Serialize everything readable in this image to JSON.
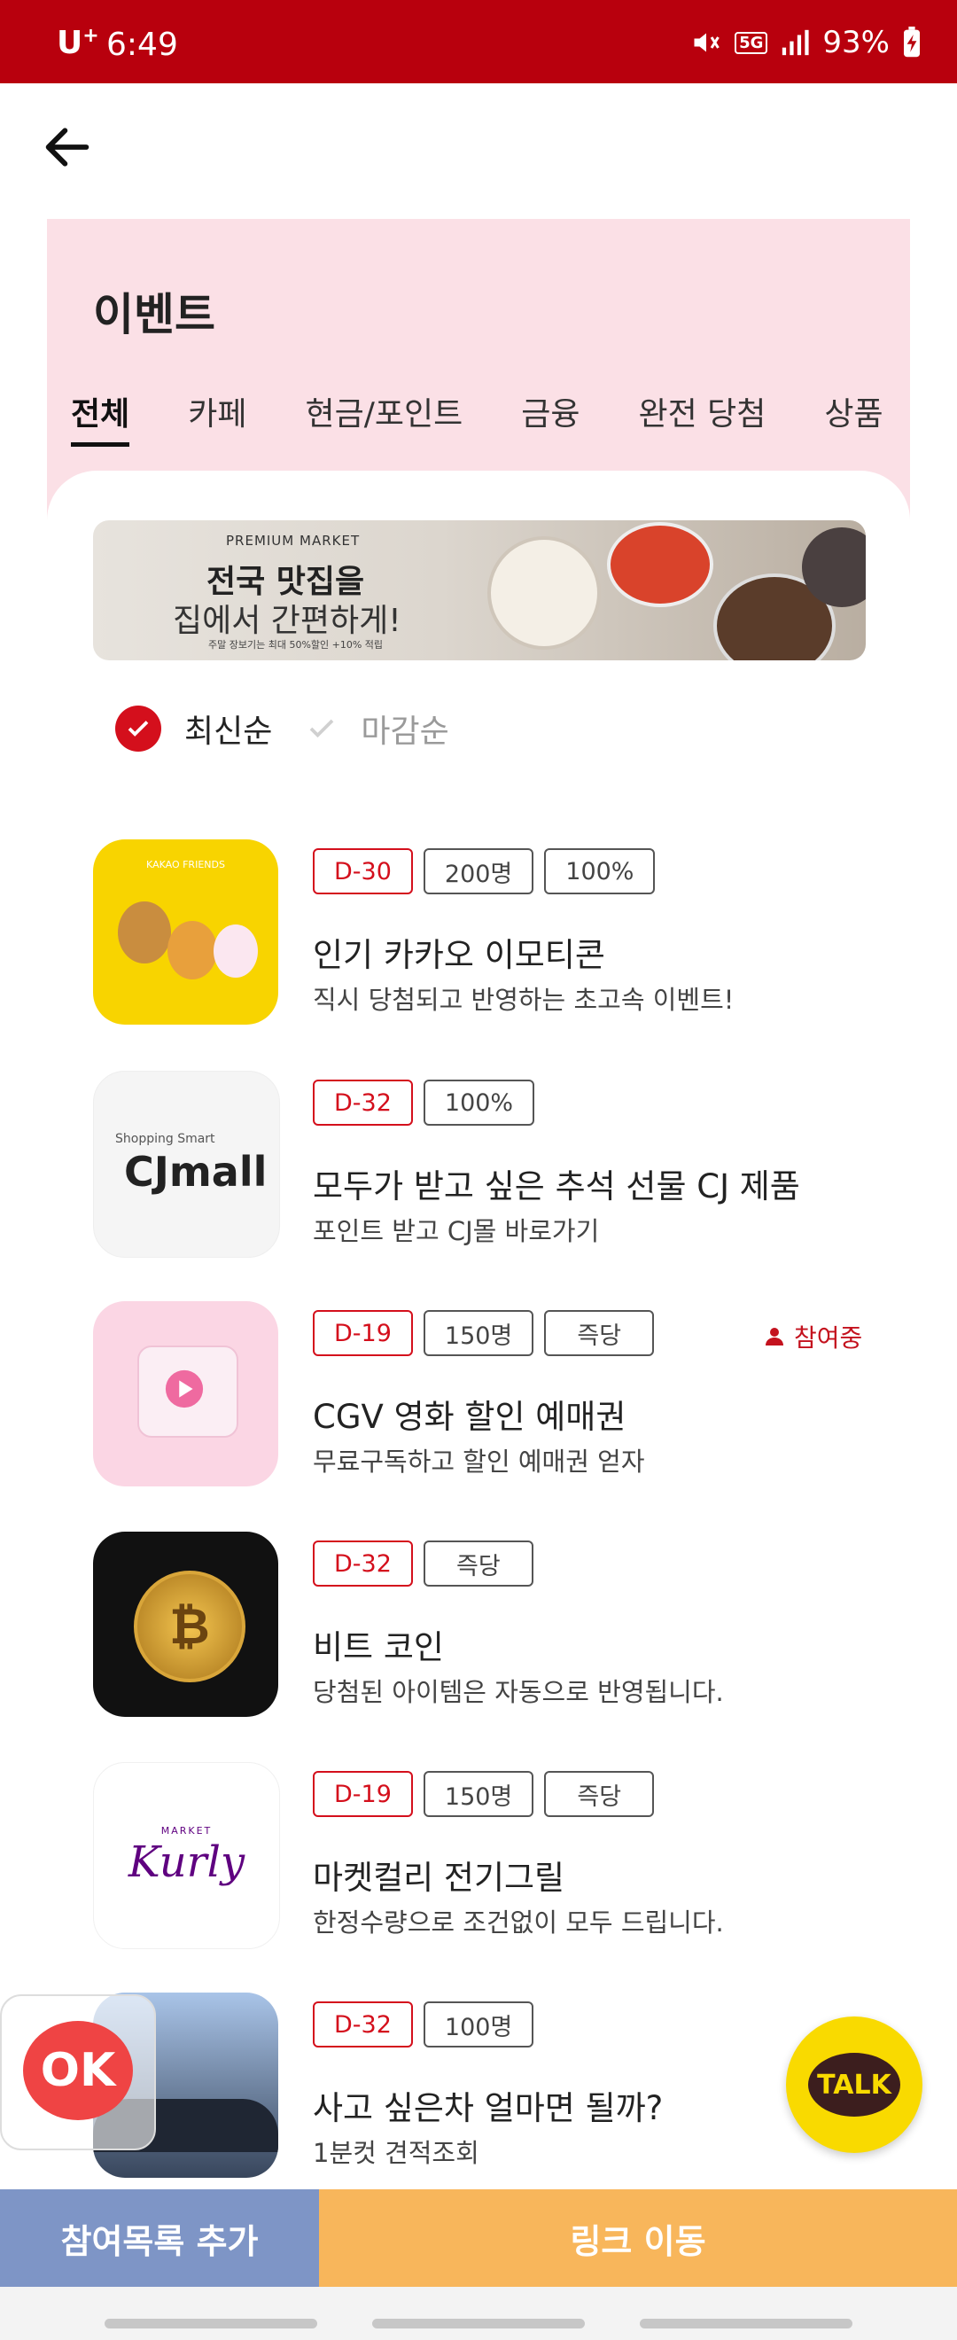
{
  "status_bar": {
    "carrier": "U",
    "carrier_plus": "+",
    "time": "6:49",
    "network": "5G",
    "battery": "93%"
  },
  "header": {
    "title": "이벤트",
    "tabs": [
      {
        "label": "전체",
        "active": true
      },
      {
        "label": "카페",
        "active": false
      },
      {
        "label": "현금/포인트",
        "active": false
      },
      {
        "label": "금융",
        "active": false
      },
      {
        "label": "완전 당첨",
        "active": false
      },
      {
        "label": "상품",
        "active": false
      }
    ]
  },
  "banner": {
    "tag": "PREMIUM MARKET",
    "line1": "전국 맛집을",
    "line2": "집에서 간편하게!",
    "fine_print": "주말 장보기는 최대 50%할인 +10% 적립"
  },
  "sort": {
    "options": [
      {
        "label": "최신순",
        "selected": true
      },
      {
        "label": "마감순",
        "selected": false
      }
    ]
  },
  "events": [
    {
      "badges": [
        {
          "text": "D-30",
          "red": true
        },
        {
          "text": "200명",
          "red": false
        },
        {
          "text": "100%",
          "red": false
        }
      ],
      "title": "인기 카카오 이모티콘",
      "subtitle": "직시 당첨되고 반영하는 초고속 이벤트!",
      "thumb_text": "KAKAO FRIENDS",
      "participating": ""
    },
    {
      "badges": [
        {
          "text": "D-32",
          "red": true
        },
        {
          "text": "100%",
          "red": false
        }
      ],
      "title": "모두가 받고 싶은 추석 선물 CJ 제품",
      "subtitle": "포인트 받고 CJ몰 바로가기",
      "thumb_text": "CJmall",
      "thumb_sub": "Shopping Smart",
      "participating": ""
    },
    {
      "badges": [
        {
          "text": "D-19",
          "red": true
        },
        {
          "text": "150명",
          "red": false
        },
        {
          "text": "즉당",
          "red": false
        }
      ],
      "title": "CGV 영화 할인 예매권",
      "subtitle": "무료구독하고 할인 예매권 얻자",
      "participating": "참여중"
    },
    {
      "badges": [
        {
          "text": "D-32",
          "red": true
        },
        {
          "text": "즉당",
          "red": false
        }
      ],
      "title": "비트 코인",
      "subtitle": "당첨된 아이템은 자동으로 반영됩니다.",
      "participating": ""
    },
    {
      "badges": [
        {
          "text": "D-19",
          "red": true
        },
        {
          "text": "150명",
          "red": false
        },
        {
          "text": "즉당",
          "red": false
        }
      ],
      "title": "마켓컬리 전기그릴",
      "subtitle": "한정수량으로 조건없이 모두 드립니다.",
      "thumb_text": "Kurly",
      "thumb_sub": "MARKET",
      "participating": ""
    },
    {
      "badges": [
        {
          "text": "D-32",
          "red": true
        },
        {
          "text": "100명",
          "red": false
        }
      ],
      "title": "사고 싶은차 얼마면 될까?",
      "subtitle": "1분컷 견적조회",
      "participating": ""
    }
  ],
  "fabs": {
    "kakao_label": "TALK",
    "ok_label": "OK"
  },
  "bottom": {
    "add_label": "참여목록 추가",
    "link_label": "링크 이동"
  },
  "colors": {
    "status_bar": "#b8000d",
    "header_bg": "#fbe0e6",
    "accent_red": "#d40f1c",
    "add_button": "#7e95c6",
    "link_button": "#f8b65b",
    "kakao_yellow": "#f9da00"
  }
}
